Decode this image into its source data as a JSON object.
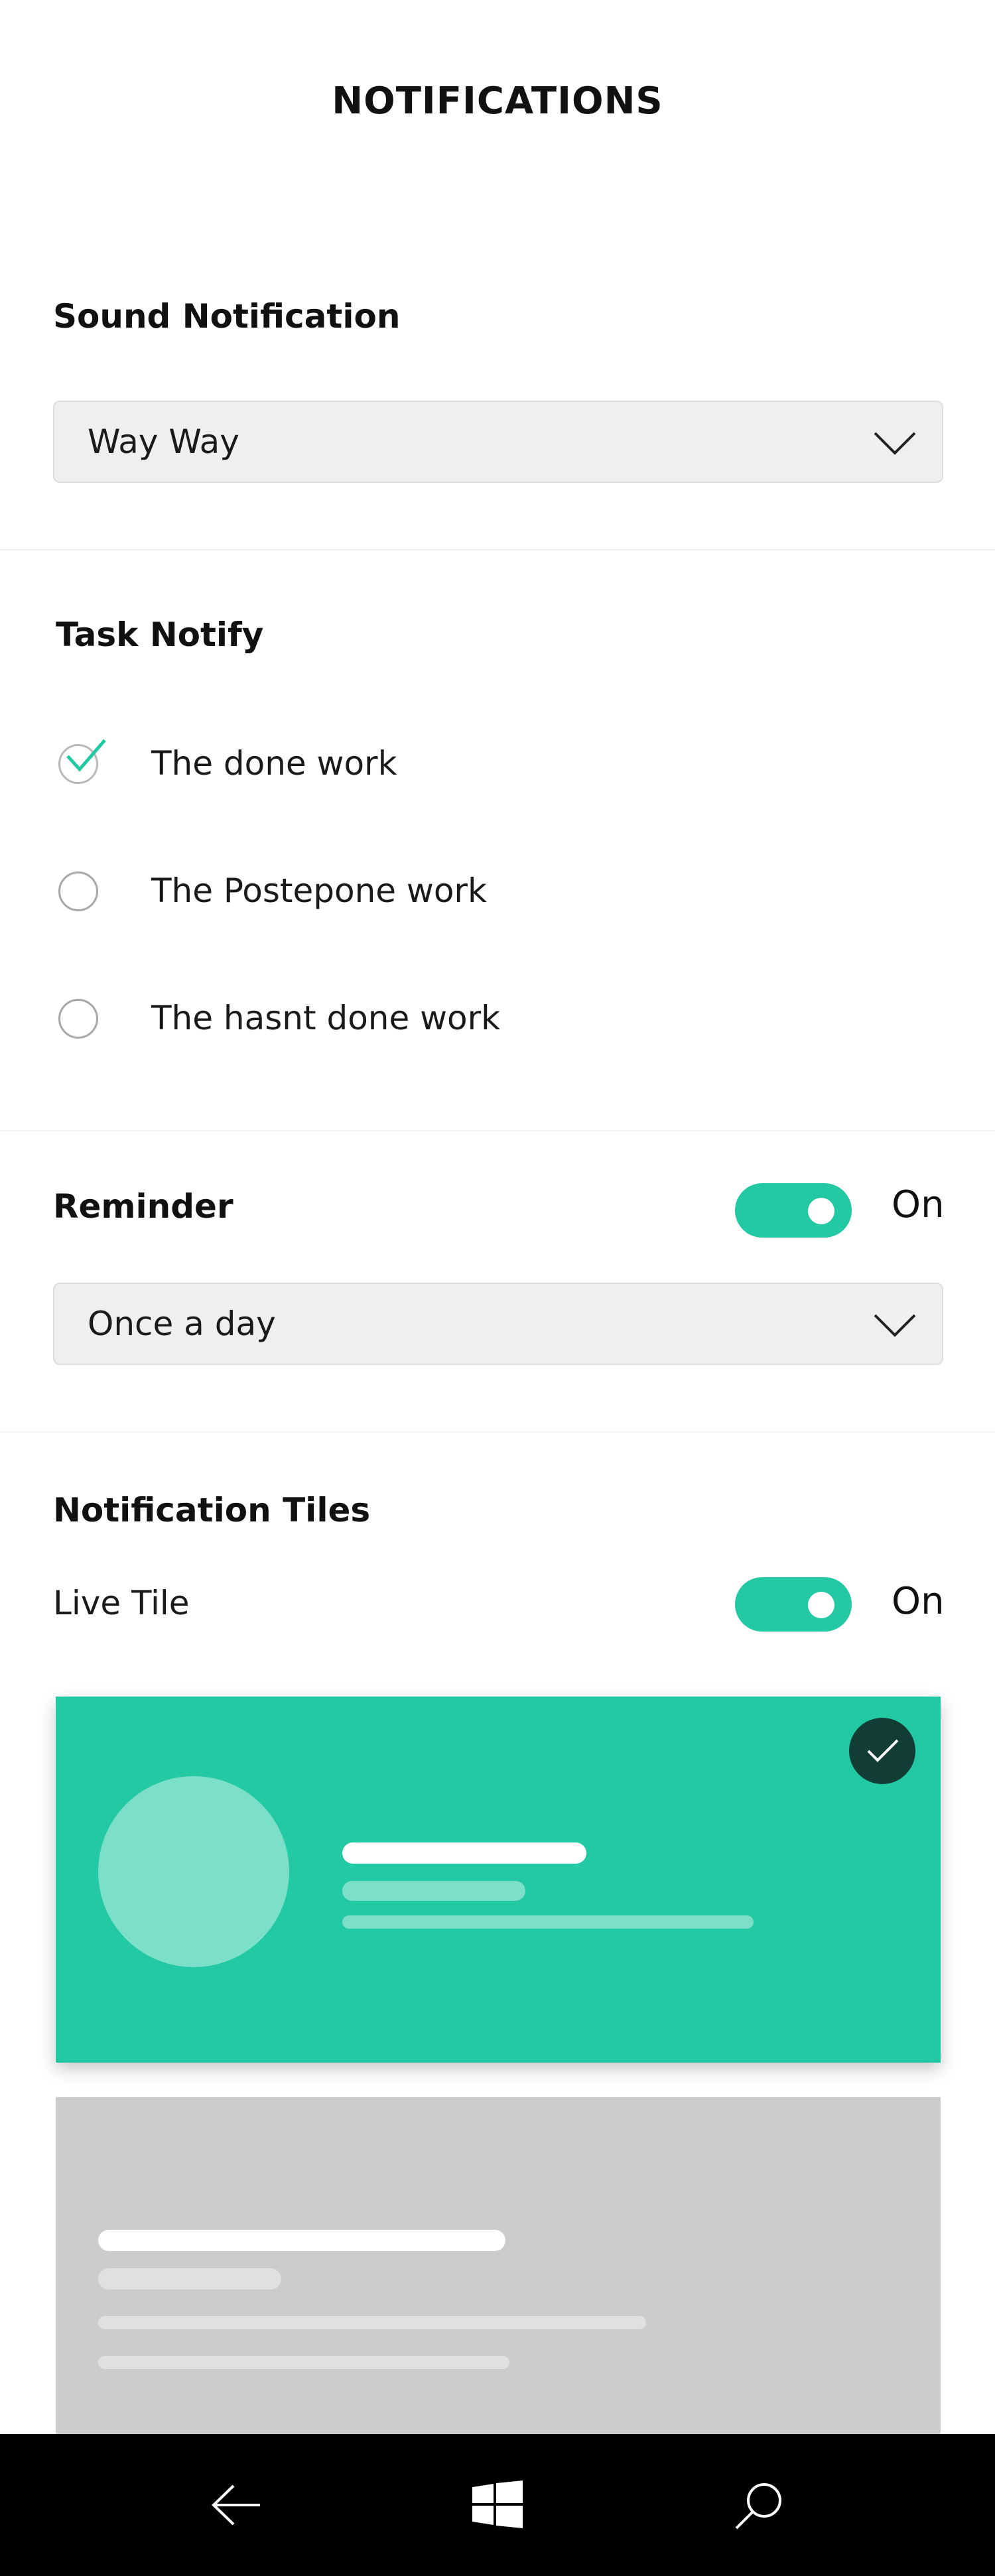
{
  "page": {
    "title": "NOTIFICATIONS"
  },
  "sound_notification": {
    "label": "Sound Notification",
    "selected": "Way Way"
  },
  "task_notify": {
    "label": "Task Notify",
    "options": [
      {
        "label": "The done work",
        "checked": true
      },
      {
        "label": "The Postepone work",
        "checked": false
      },
      {
        "label": "The hasnt done work",
        "checked": false
      }
    ]
  },
  "reminder": {
    "label": "Reminder",
    "toggle_state": "On",
    "selected": "Once a day"
  },
  "notification_tiles": {
    "label": "Notification Tiles",
    "live_tile_label": "Live Tile",
    "toggle_state": "On"
  },
  "colors": {
    "accent": "#22c9a2",
    "check_badge": "#123d35",
    "tile_inactive": "#cccccc",
    "nav_bar": "#000000"
  },
  "icons": {
    "dropdown": "chevron-down-icon",
    "selected_tile": "checkmark-icon",
    "nav_back": "back-arrow-icon",
    "nav_home": "windows-logo-icon",
    "nav_search": "search-icon"
  }
}
